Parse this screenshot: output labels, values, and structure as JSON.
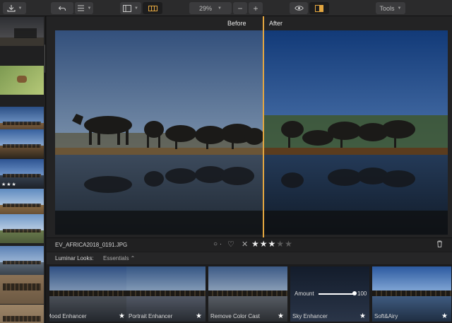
{
  "toolbar": {
    "zoom_value": "29%",
    "zoom_minus": "−",
    "zoom_plus": "+",
    "tools_label": "Tools"
  },
  "filmstrip": {
    "selected_rating": "★★★"
  },
  "viewer": {
    "before_label": "Before",
    "after_label": "After"
  },
  "infobar": {
    "filename": "EV_AFRICA2018_0191.JPG",
    "flag": "○ ·",
    "favorite": "♡",
    "reject": "✕",
    "rating": 3,
    "rating_max": 5
  },
  "looks": {
    "title": "Luminar Looks:",
    "category": "Essentials  ⌃",
    "amount_label": "Amount",
    "amount_value": "100",
    "presets": [
      {
        "name": "Mood Enhancer"
      },
      {
        "name": "Portrait Enhancer"
      },
      {
        "name": "Remove Color Cast"
      },
      {
        "name": "Sky Enhancer"
      },
      {
        "name": "Soft&Airy"
      }
    ]
  },
  "colors": {
    "accent": "#e3a640",
    "background": "#1b1b1c",
    "toolbar": "#2b2b2c"
  }
}
